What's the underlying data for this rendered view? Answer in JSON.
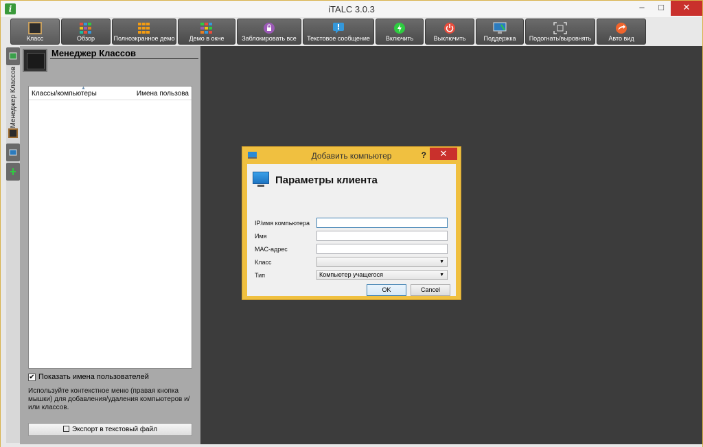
{
  "window": {
    "title": "iTALC 3.0.3",
    "app_icon": "i",
    "minimize": "–",
    "maximize": "□",
    "close": "✕"
  },
  "toolbar": [
    {
      "label": "Класс",
      "icon": "classroom-icon",
      "color": "#2b2b2b"
    },
    {
      "label": "Обзор",
      "icon": "overview-icon",
      "color": "#cc3333"
    },
    {
      "label": "Полноэкранное демо",
      "icon": "fullscreen-demo-icon",
      "color": "#f39c12"
    },
    {
      "label": "Демо в окне",
      "icon": "window-demo-icon",
      "color": "#27ae60"
    },
    {
      "label": "Заблокировать все",
      "icon": "lock-icon",
      "color": "#9b59b6"
    },
    {
      "label": "Текстовое сообщение",
      "icon": "message-icon",
      "color": "#3498db"
    },
    {
      "label": "Включить",
      "icon": "power-on-icon",
      "color": "#2ecc40"
    },
    {
      "label": "Выключить",
      "icon": "power-off-icon",
      "color": "#e74c3c"
    },
    {
      "label": "Поддержка",
      "icon": "support-icon",
      "color": "#2c7bbd"
    },
    {
      "label": "Подогнать/выровнять",
      "icon": "fit-align-icon",
      "color": "#dddddd"
    },
    {
      "label": "Авто вид",
      "icon": "auto-view-icon",
      "color": "#f0642c"
    }
  ],
  "sidebar": {
    "vertical_tab_label": "Менеджер Классов"
  },
  "panel": {
    "title": "Менеджер Классов",
    "tree": {
      "columns": [
        "Классы/компьютеры",
        "Имена пользова"
      ],
      "rows": []
    },
    "show_usernames_checked": true,
    "show_usernames_label": "Показать имена пользователей",
    "hint": "Используйте контекстное меню (правая кнопка мышки) для добавления/удаления компьютеров и/или классов.",
    "export_label": "Экспорт в текстовый файл"
  },
  "dialog": {
    "title": "Добавить компьютер",
    "help": "?",
    "close": "✕",
    "heading": "Параметры клиента",
    "fields": {
      "ip_label": "IP/имя компьютера",
      "ip_value": "",
      "name_label": "Имя",
      "name_value": "",
      "mac_label": "MAC-адрес",
      "mac_value": "",
      "class_label": "Класс",
      "class_value": "",
      "type_label": "Тип",
      "type_value": "Компьютер учащегося"
    },
    "ok_label": "OK",
    "cancel_label": "Cancel"
  }
}
